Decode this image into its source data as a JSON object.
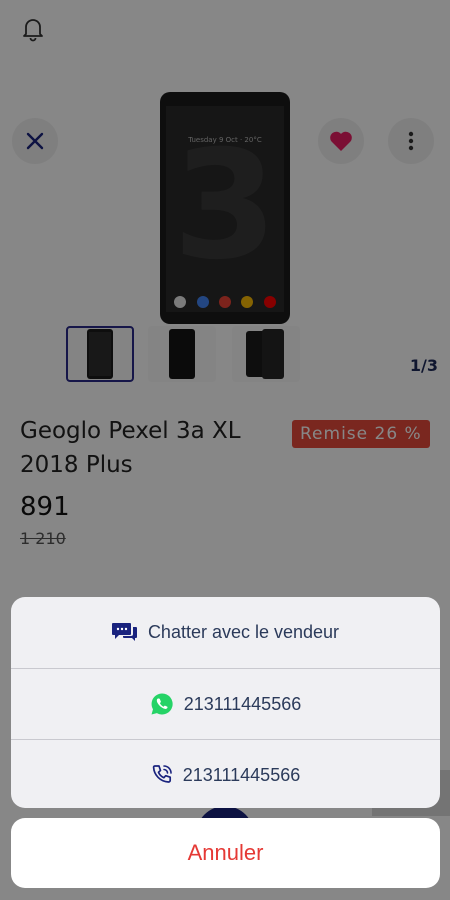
{
  "header": {
    "notification_icon": "bell-icon"
  },
  "gallery": {
    "counter": "1/3",
    "close_icon": "close-icon",
    "favorite_icon": "heart-icon",
    "more_icon": "more-vertical-icon",
    "thumbnails": [
      "phone-front",
      "phone-back",
      "phone-front-dark"
    ]
  },
  "product": {
    "title": "Geoglo Pexel 3a XL 2018 Plus",
    "discount_badge": "Remise 26 %",
    "price": "891",
    "old_price": "1 210"
  },
  "action_sheet": {
    "chat_label": "Chatter avec le vendeur",
    "whatsapp_number": "213111445566",
    "phone_number": "213111445566",
    "cancel_label": "Annuler"
  },
  "colors": {
    "accent": "#1a237e",
    "discount": "#e64a3b",
    "favorite": "#e91e63",
    "cancel": "#e53935",
    "whatsapp": "#25d366"
  }
}
